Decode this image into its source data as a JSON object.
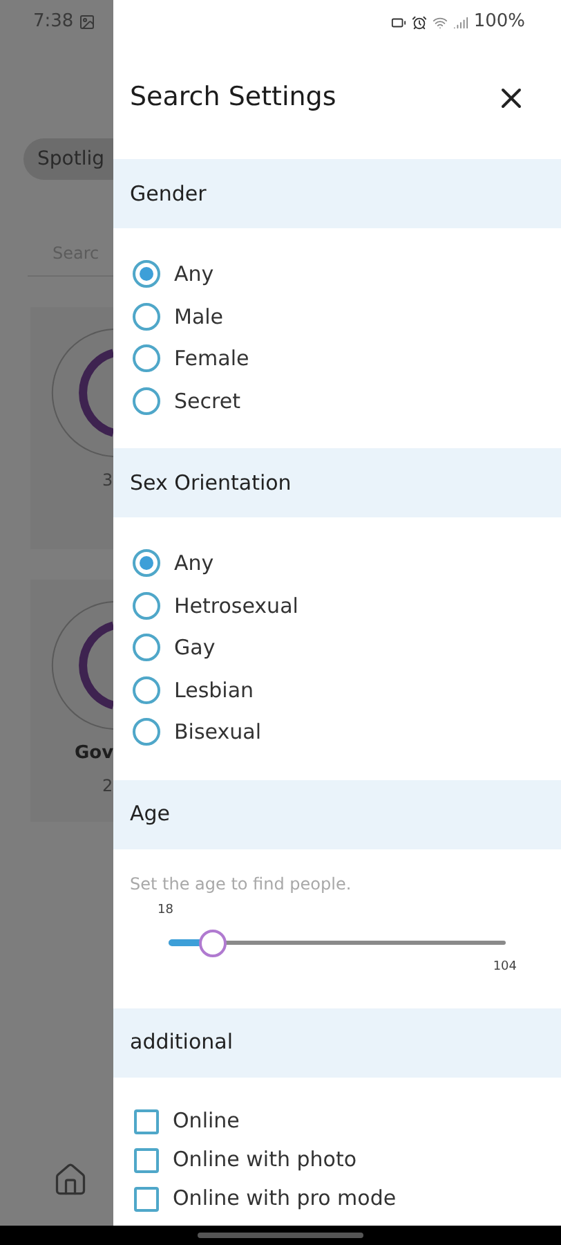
{
  "status_bar": {
    "time": "7:38",
    "battery": "100%"
  },
  "background": {
    "chip": "Spotlig",
    "search_placeholder": "Searc",
    "cards": [
      {
        "count": "3"
      },
      {
        "name": "Gov",
        "count": "2"
      }
    ]
  },
  "drawer": {
    "title": "Search Settings",
    "sections": [
      {
        "kind": "radio",
        "heading": "Gender",
        "options": [
          {
            "label": "Any",
            "selected": true
          },
          {
            "label": "Male",
            "selected": false
          },
          {
            "label": "Female",
            "selected": false
          },
          {
            "label": "Secret",
            "selected": false
          }
        ]
      },
      {
        "kind": "radio",
        "heading": "Sex Orientation",
        "options": [
          {
            "label": "Any",
            "selected": true
          },
          {
            "label": "Hetrosexual",
            "selected": false
          },
          {
            "label": "Gay",
            "selected": false
          },
          {
            "label": "Lesbian",
            "selected": false
          },
          {
            "label": "Bisexual",
            "selected": false
          }
        ]
      },
      {
        "kind": "slider",
        "heading": "Age",
        "hint": "Set the age to find people.",
        "min_label": "18",
        "max_label": "104",
        "level": 0.13
      },
      {
        "kind": "checkbox",
        "heading": "additional",
        "options": [
          {
            "label": "Online",
            "checked": false
          },
          {
            "label": "Online with photo",
            "checked": false
          },
          {
            "label": "Online with pro mode",
            "checked": false
          }
        ]
      }
    ]
  }
}
